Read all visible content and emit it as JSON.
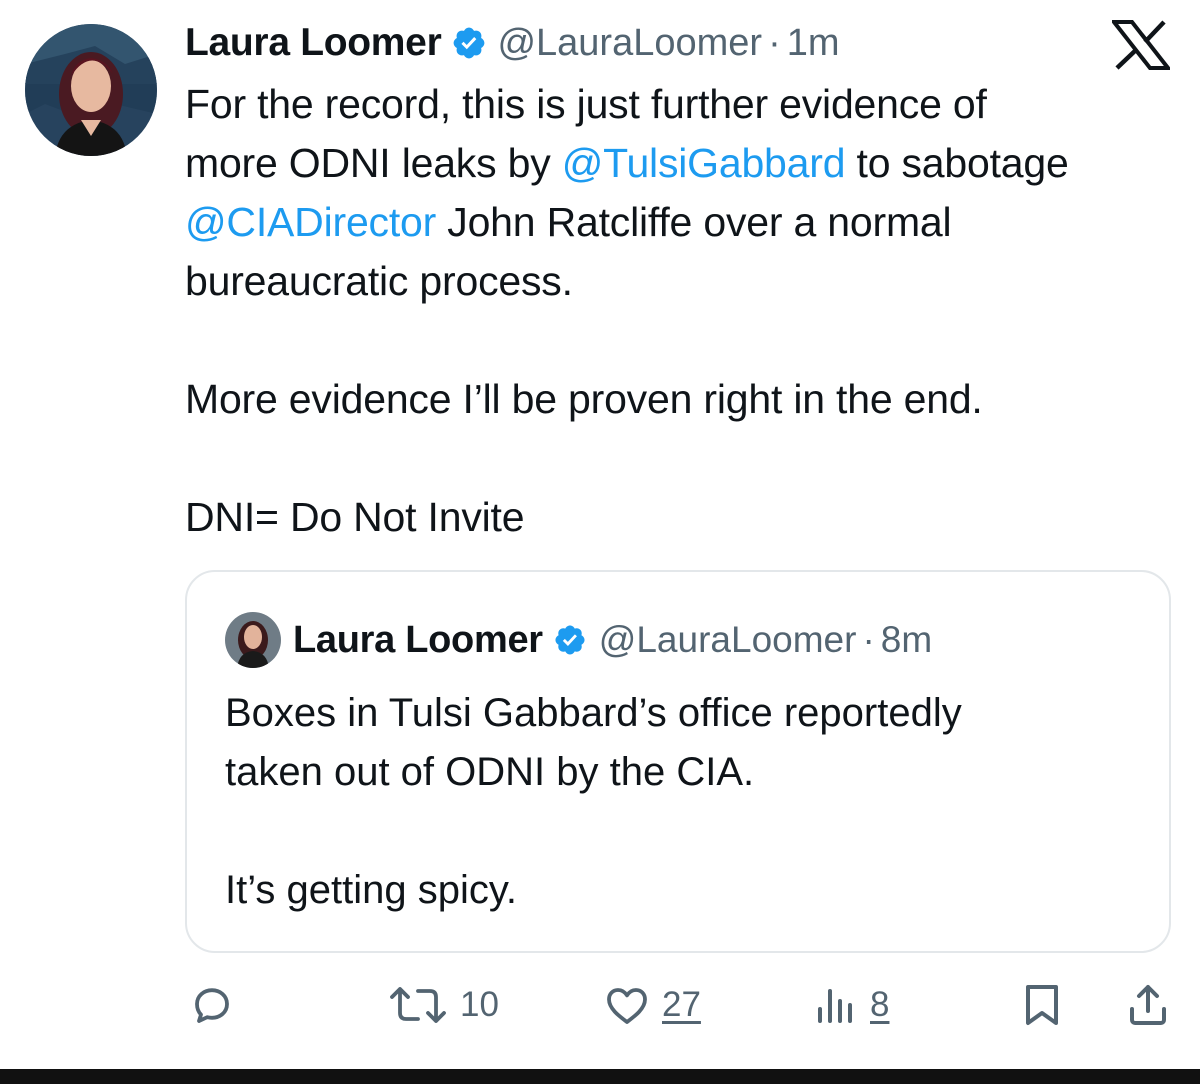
{
  "tweet": {
    "author_name": "Laura Loomer",
    "handle": "@LauraLoomer",
    "separator": "·",
    "time": "1m",
    "text_lines": [
      [
        {
          "t": "For the record, this is just further evidence of"
        }
      ],
      [
        {
          "t": "more ODNI leaks by "
        },
        {
          "t": "@TulsiGabbard",
          "mention": true
        },
        {
          "t": " to sabotage"
        }
      ],
      [
        {
          "t": "@CIADirector",
          "mention": true
        },
        {
          "t": " John Ratcliffe over a normal"
        }
      ],
      [
        {
          "t": "bureaucratic process."
        }
      ],
      [],
      [
        {
          "t": "More evidence I’ll be proven right in the end."
        }
      ],
      [],
      [
        {
          "t": "DNI= Do Not Invite"
        }
      ]
    ]
  },
  "quoted_tweet": {
    "author_name": "Laura Loomer",
    "handle": "@LauraLoomer",
    "separator": "·",
    "time": "8m",
    "text_lines": [
      "Boxes in Tulsi Gabbard’s office reportedly",
      "taken out of ODNI by the CIA.",
      "",
      "It’s getting spicy."
    ]
  },
  "actions": {
    "reply": {
      "icon": "reply-icon",
      "count": ""
    },
    "retweet": {
      "icon": "retweet-icon",
      "count": "10"
    },
    "like": {
      "icon": "heart-icon",
      "count": "27"
    },
    "views": {
      "icon": "views-icon",
      "count": "8"
    },
    "bookmark": {
      "icon": "bookmark-icon"
    },
    "share": {
      "icon": "share-icon"
    }
  },
  "brand": {
    "logo": "x-logo-icon"
  },
  "colors": {
    "text": "#0f1419",
    "secondary": "#536471",
    "accent": "#1d9bf0",
    "border": "#e3e7ea"
  }
}
